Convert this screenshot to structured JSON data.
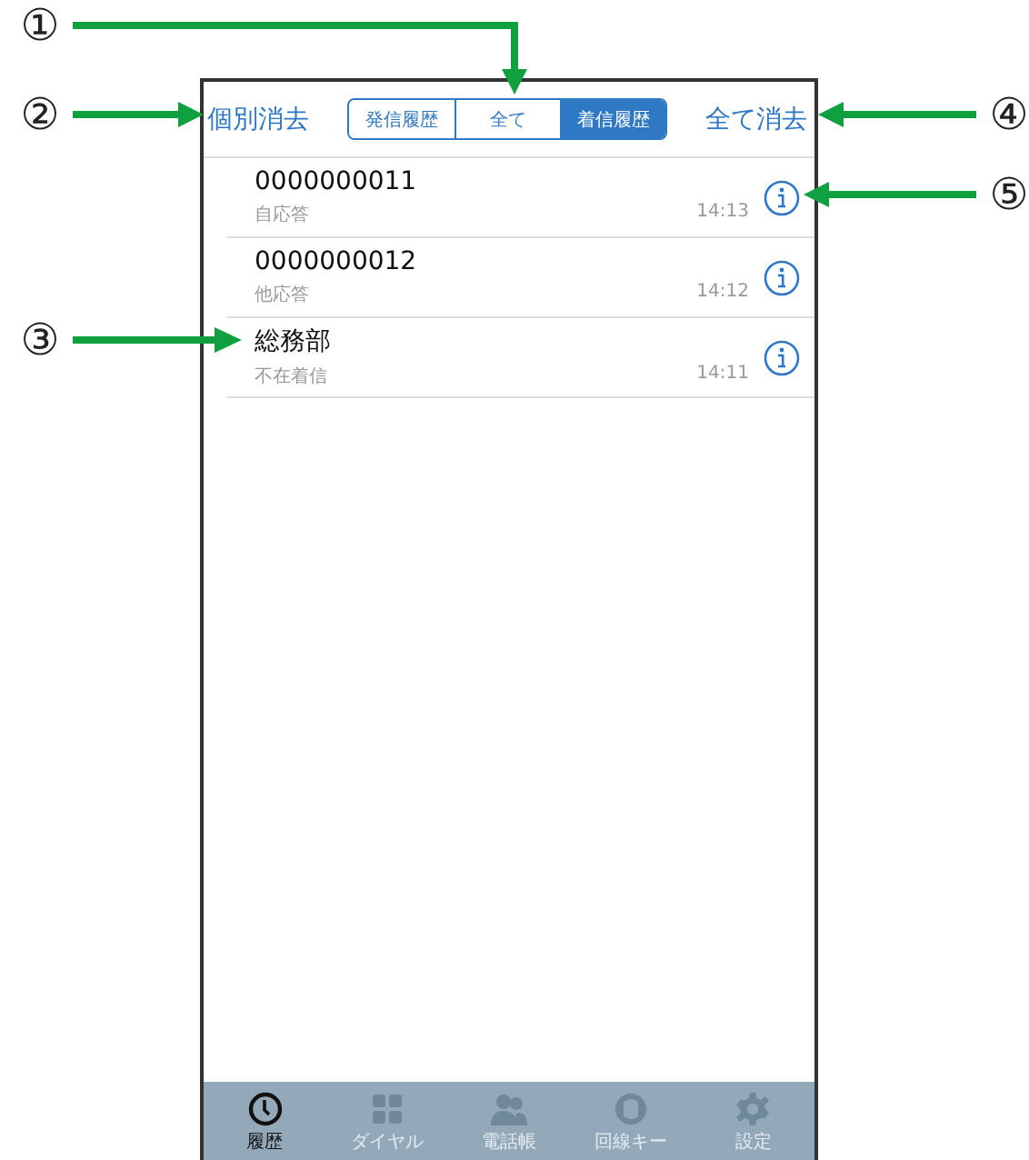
{
  "annotations": [
    {
      "number": "①"
    },
    {
      "number": "②"
    },
    {
      "number": "③"
    },
    {
      "number": "④"
    },
    {
      "number": "⑤"
    }
  ],
  "header": {
    "left_button": "個別消去",
    "right_button": "全て消去",
    "segments": [
      {
        "label": "発信履歴",
        "selected": false
      },
      {
        "label": "全て",
        "selected": false
      },
      {
        "label": "着信履歴",
        "selected": true
      }
    ]
  },
  "calls": [
    {
      "name": "0000000011",
      "status": "自応答",
      "time": "14:13"
    },
    {
      "name": "0000000012",
      "status": "他応答",
      "time": "14:12"
    },
    {
      "name": "総務部",
      "status": "不在着信",
      "time": "14:11"
    }
  ],
  "tab_bar": [
    {
      "label": "履歴",
      "kind": "clock",
      "selected": true
    },
    {
      "label": "ダイヤル",
      "kind": "grid",
      "selected": false
    },
    {
      "label": "電話帳",
      "kind": "people",
      "selected": false
    },
    {
      "label": "回線キー",
      "kind": "lines",
      "selected": false
    },
    {
      "label": "設定",
      "kind": "gear",
      "selected": false
    }
  ]
}
